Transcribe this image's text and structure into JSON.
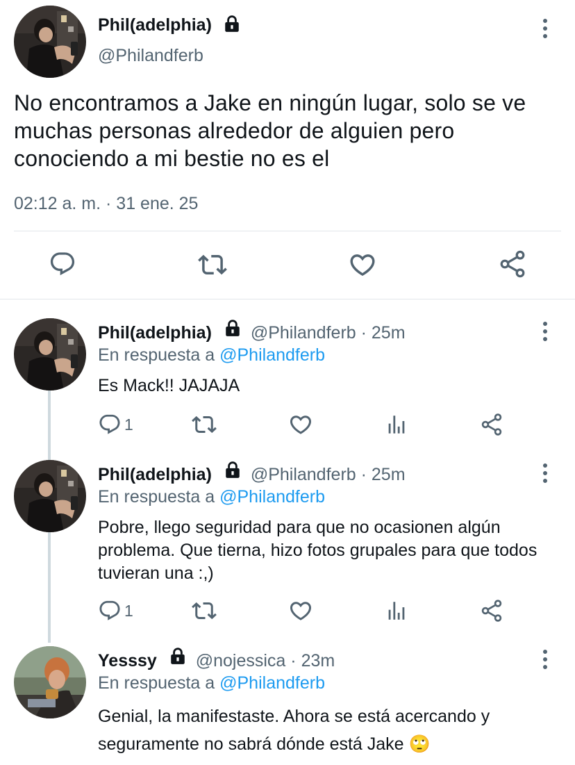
{
  "main_tweet": {
    "author_name": "Phil(adelphia)",
    "handle": "@Philandferb",
    "text": "No encontramos a Jake en ningún lugar, solo se ve muchas personas alrededor de alguien pero conociendo a mi bestie no es el",
    "timestamp": "02:12 a. m. · 31 ene. 25",
    "actions": [
      "reply-icon",
      "retweet-icon",
      "like-icon",
      "share-icon"
    ]
  },
  "replies": [
    {
      "author_name": "Phil(adelphia)",
      "handle": "@Philandferb",
      "time": "25m",
      "in_reply_prefix": "En respuesta a",
      "in_reply_handle": "@Philandferb",
      "text": "Es Mack!! JAJAJA",
      "reply_count": "1"
    },
    {
      "author_name": "Phil(adelphia)",
      "handle": "@Philandferb",
      "time": "25m",
      "in_reply_prefix": "En respuesta a",
      "in_reply_handle": "@Philandferb",
      "text": "Pobre, llego seguridad para que no ocasionen algún problema. Que tierna, hizo fotos grupales para que todos tuvieran una :,)",
      "reply_count": "1"
    },
    {
      "author_name": "Yesssy",
      "handle": "@nojessica",
      "time": "23m",
      "in_reply_prefix": "En respuesta a",
      "in_reply_handle": "@Philandferb",
      "text": "Genial, la manifestaste. Ahora se está acercando y seguramente no sabrá dónde está Jake 🙄"
    }
  ],
  "separator": " · ",
  "colors": {
    "accent": "#1d9bf0",
    "secondary_text": "#536471",
    "divider": "#e1e6ea",
    "thread_line": "#cfd9de"
  }
}
